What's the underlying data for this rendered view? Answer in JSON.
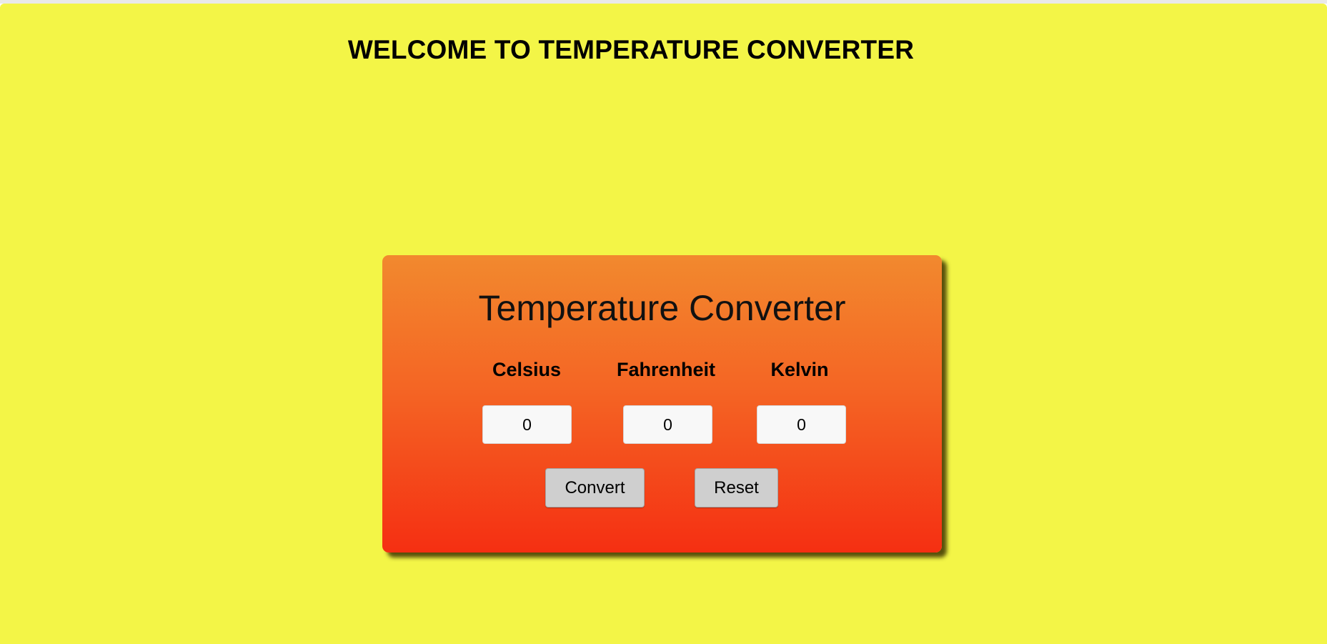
{
  "page": {
    "heading": "WELCOME TO TEMPERATURE CONVERTER",
    "background_color": "#f3f547"
  },
  "converter": {
    "title": "Temperature Converter",
    "gradient_colors": [
      "#f2892e",
      "#f46524",
      "#f52f12"
    ],
    "fields": [
      {
        "label": "Celsius",
        "value": "0"
      },
      {
        "label": "Fahrenheit",
        "value": "0"
      },
      {
        "label": "Kelvin",
        "value": "0"
      }
    ],
    "buttons": {
      "convert_label": "Convert",
      "reset_label": "Reset"
    }
  }
}
